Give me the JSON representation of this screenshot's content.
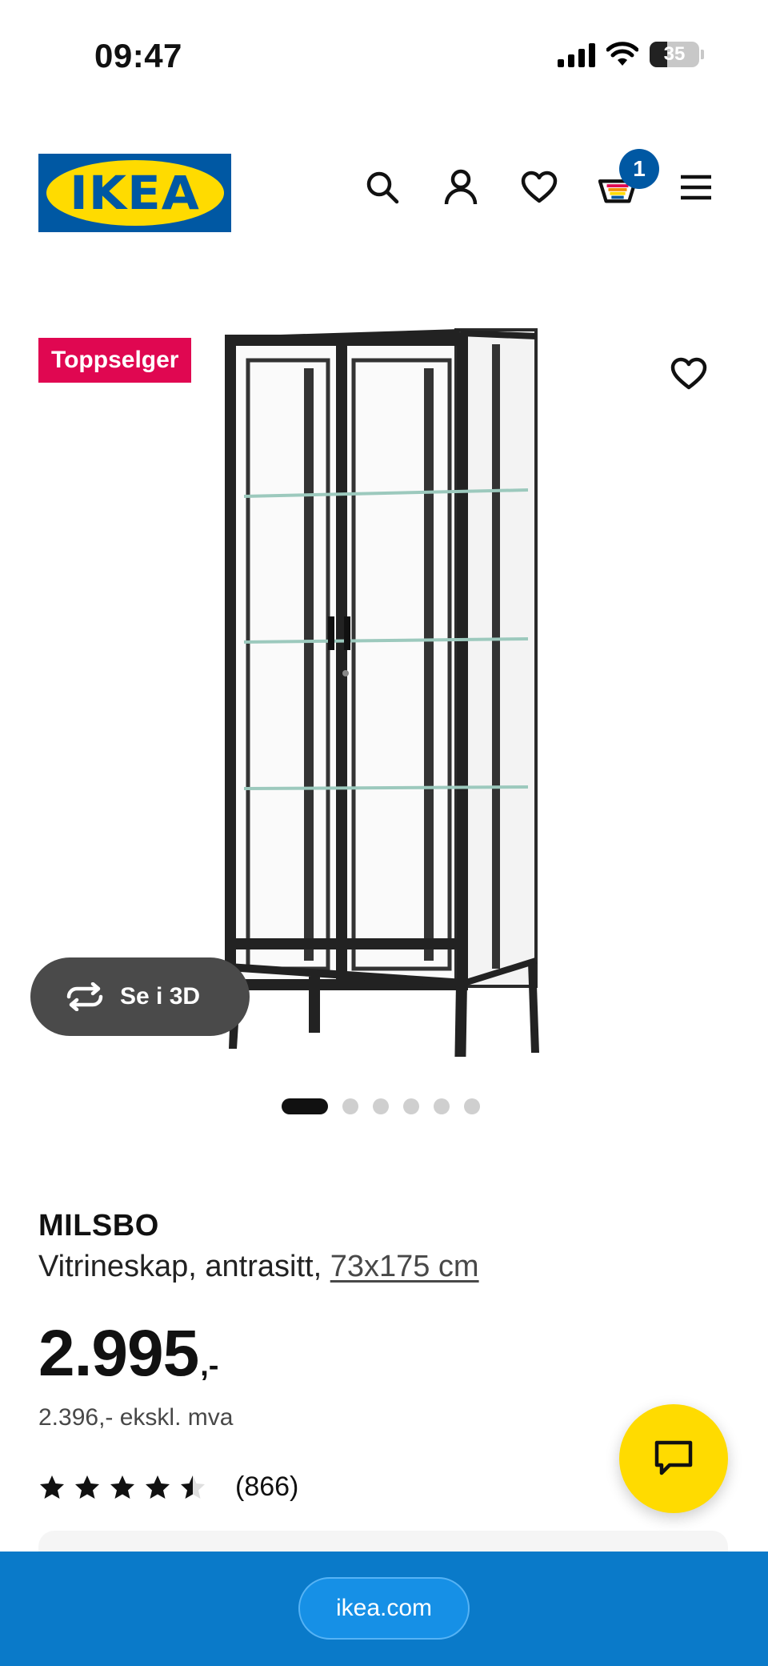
{
  "status_bar": {
    "time": "09:47",
    "battery": "35",
    "battery_level": 0.35
  },
  "header": {
    "logo_text": "IKEA",
    "cart_count": "1",
    "icons": [
      "search-icon",
      "user-icon",
      "heart-icon",
      "cart-icon",
      "menu-icon"
    ]
  },
  "product_image": {
    "badge": "Toppselger",
    "view_3d_label": "Se i 3D",
    "carousel_total": 6,
    "carousel_active": 1
  },
  "product": {
    "name": "MILSBO",
    "description": "Vitrineskap, antrasitt, ",
    "size": "73x175 cm",
    "price": "2.995",
    "price_suffix": ",-",
    "price_ex_vat": "2.396,- ekskl. mva",
    "rating": 4.5,
    "review_count": "(866)"
  },
  "bottom_bar": {
    "url": "ikea.com"
  },
  "colors": {
    "ikea_blue": "#0058a3",
    "ikea_yellow": "#ffdb00",
    "badge_pink": "#e00751",
    "bottom_bar": "#0a7ac9"
  }
}
